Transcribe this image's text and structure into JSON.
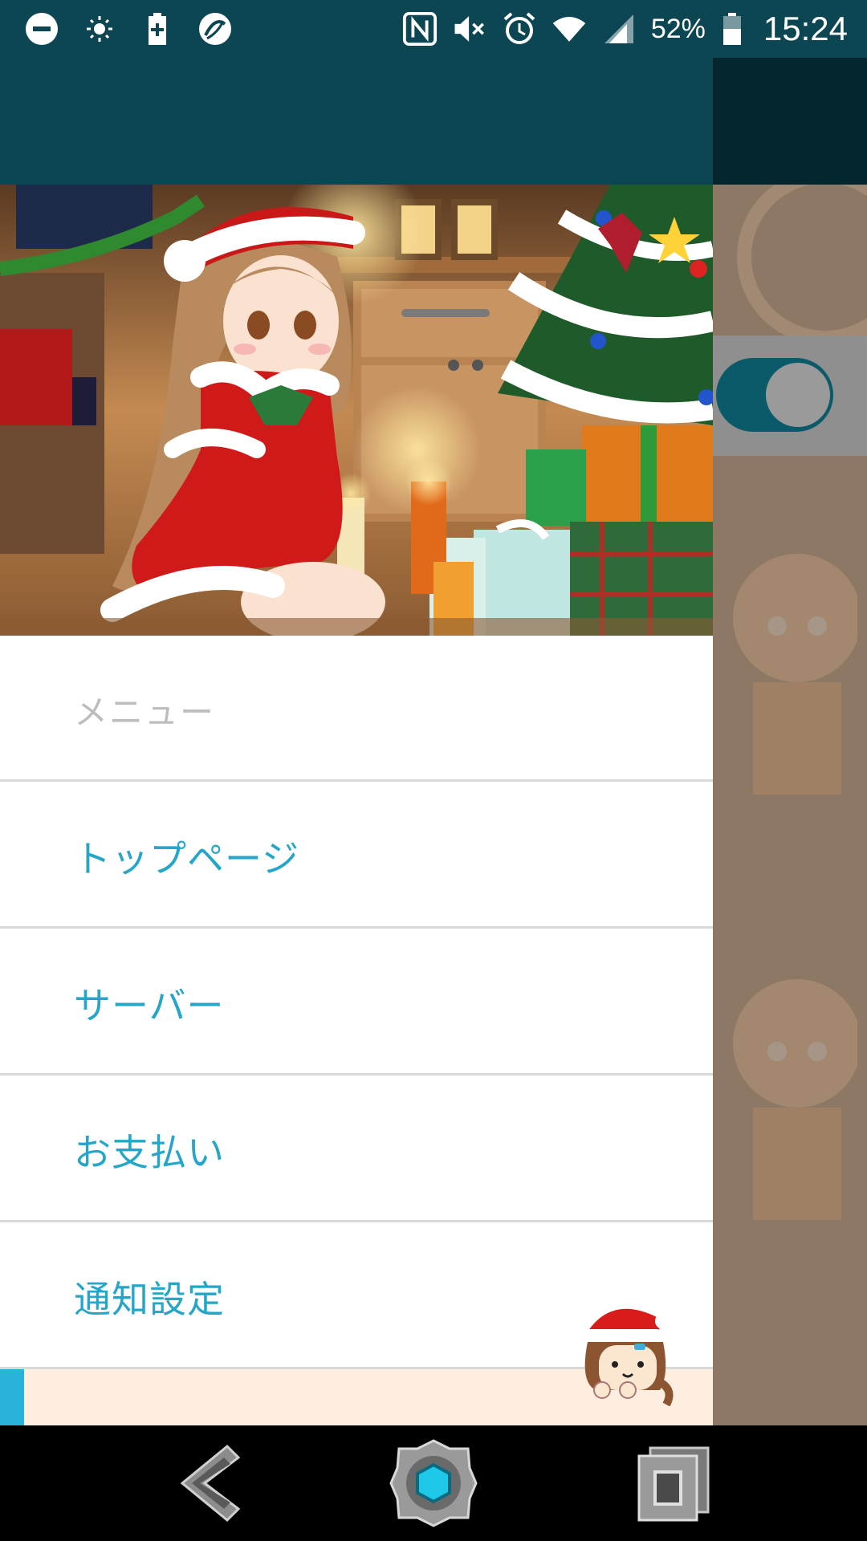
{
  "status_bar": {
    "battery_percent": "52%",
    "time": "15:24",
    "icons": [
      "do-not-disturb-icon",
      "brightness-icon",
      "battery-saver-icon",
      "app-notification-icon",
      "nfc-icon",
      "mute-icon",
      "alarm-icon",
      "wifi-icon",
      "signal-icon",
      "battery-icon"
    ]
  },
  "drawer": {
    "banner_image": "christmas-banner-illustration",
    "menu_header": "メニュー",
    "items": [
      {
        "label": "トップページ"
      },
      {
        "label": "サーバー"
      },
      {
        "label": "お支払い"
      },
      {
        "label": "通知設定"
      }
    ],
    "accent_color": "#25a6c8"
  },
  "nav_bar": {
    "buttons": [
      "back-icon",
      "home-icon",
      "recents-icon"
    ]
  },
  "colors": {
    "header": "#0b4652",
    "menu_text": "#25a6c8",
    "footer_strip": "#fdeee0"
  }
}
